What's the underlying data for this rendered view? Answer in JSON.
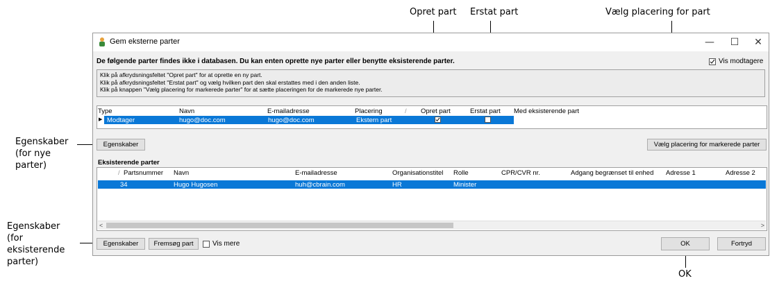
{
  "annotations": {
    "opret_part": "Opret part",
    "erstat_part": "Erstat part",
    "vaelg_placering": "Vælg placering for part",
    "egenskaber_nye": [
      "Egenskaber",
      "(for nye",
      "parter)"
    ],
    "egenskaber_eksisterende": [
      "Egenskaber",
      "(for",
      "eksisterende",
      "parter)"
    ],
    "ok": "OK"
  },
  "window": {
    "title": "Gem eksterne parter",
    "minimize_glyph": "—",
    "maximize_glyph": "☐",
    "close_glyph": "✕"
  },
  "headline": "De følgende parter findes ikke i databasen.  Du kan enten oprette nye parter eller benytte eksisterende parter.",
  "vis_modtagere": {
    "label": "Vis modtagere",
    "checked": true
  },
  "instructions": [
    "Klik på afkrydsningsfeltet \"Opret part\" for at oprette en ny part.",
    "Klik på afkrydsningsfeltet \"Erstat part\" og vælg hvilken part den skal erstattes med i den anden liste.",
    "Klik på knappen \"Vælg placering for markerede parter\" for at sætte placeringen for de markerede nye parter."
  ],
  "new_parties_grid": {
    "headers": {
      "type": "Type",
      "navn": "Navn",
      "email": "E-mailadresse",
      "placering": "Placering",
      "opret": "Opret part",
      "erstat": "Erstat part",
      "med": "Med eksisterende part"
    },
    "row": {
      "type": "Modtager",
      "navn": "hugo@doc.com",
      "email": "hugo@doc.com",
      "placering": "Ekstern part",
      "opret_checked": true,
      "erstat_checked": false
    }
  },
  "buttons": {
    "egenskaber_top": "Egenskaber",
    "vaelg_placering": "Vælg placering for markerede parter",
    "egenskaber_bottom": "Egenskaber",
    "fremsoeg": "Fremsøg part",
    "ok": "OK",
    "fortryd": "Fortryd"
  },
  "existing_section_label": "Eksisterende parter",
  "existing_grid": {
    "headers": [
      "Partsnummer",
      "Navn",
      "E-mailadresse",
      "Organisationstitel",
      "Rolle",
      "CPR/CVR nr.",
      "Adgang begrænset til enhed",
      "Adresse 1",
      "Adresse 2"
    ],
    "row": [
      "34",
      "Hugo Hugosen",
      "huh@cbrain.com",
      "HR",
      "Minister",
      "",
      "",
      "",
      ""
    ]
  },
  "vis_mere": {
    "label": "Vis mere",
    "checked": false
  },
  "colors": {
    "selection": "#0a78d7",
    "window_bg": "#f0f0f0",
    "button_bg": "#e1e1e1"
  }
}
